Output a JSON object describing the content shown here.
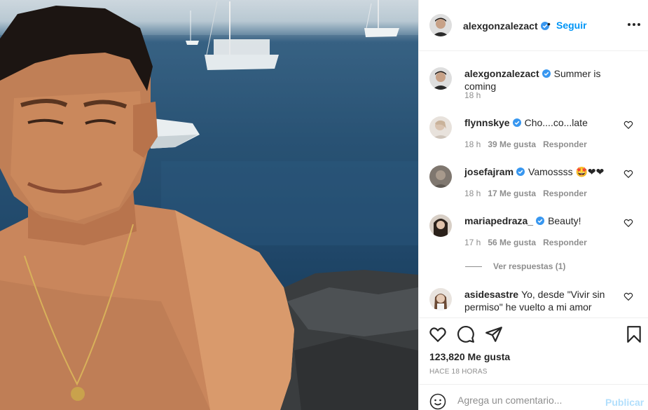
{
  "post": {
    "author": "alexgonzalezact",
    "follow_label": "Seguir",
    "dot": "•",
    "caption": "Summer is coming",
    "caption_time": "18 h"
  },
  "comments": [
    {
      "user": "flynnskye",
      "text": "Cho....co...late",
      "time": "18 h",
      "likes": "39 Me gusta",
      "reply": "Responder"
    },
    {
      "user": "josefajram",
      "text": "Vamossss 🤩❤❤",
      "time": "18 h",
      "likes": "17 Me gusta",
      "reply": "Responder"
    },
    {
      "user": "mariapedraza_",
      "text": "Beauty!",
      "time": "17 h",
      "likes": "56 Me gusta",
      "reply": "Responder"
    },
    {
      "user": "asidesastre",
      "text": "Yo, desde \"Vivir sin permiso\" he vuelto a mi amor"
    }
  ],
  "view_replies": "Ver respuestas (1)",
  "likes_count": "123,820 Me gusta",
  "posted_ago": "HACE 18 HORAS",
  "add_comment": {
    "placeholder": "Agrega un comentario...",
    "post_label": "Publicar"
  },
  "colors": {
    "link_blue": "#0095f6",
    "verified_blue": "#3897f0",
    "muted": "#8e8e8e",
    "disabled_blue": "#b2dffc"
  },
  "icons": [
    "more-options-icon",
    "heart-icon",
    "comment-icon",
    "share-icon",
    "bookmark-icon",
    "emoji-icon",
    "verified-icon"
  ]
}
